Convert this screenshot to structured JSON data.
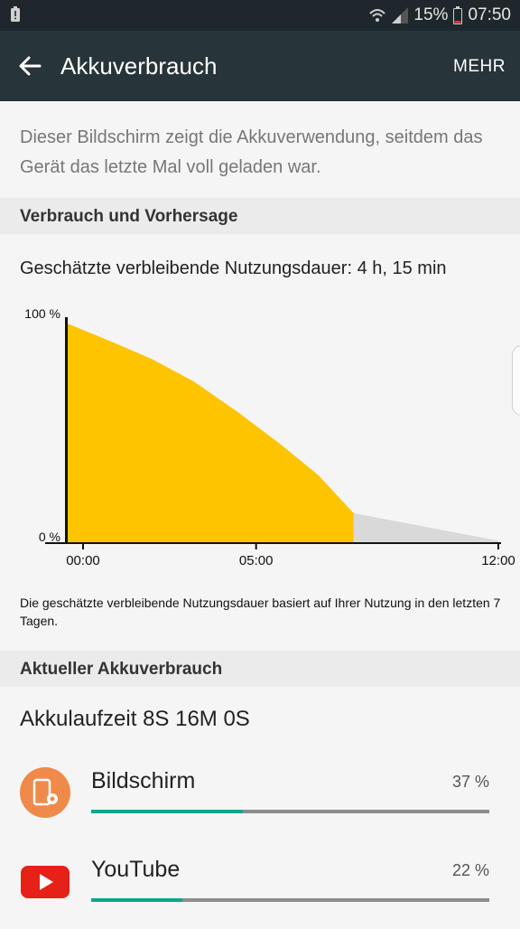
{
  "status_bar": {
    "battery_percent": "15%",
    "time": "07:50"
  },
  "app_bar": {
    "title": "Akkuverbrauch",
    "more_label": "MEHR"
  },
  "intro_text": "Dieser Bildschirm zeigt die Akkuverwendung, seitdem das Gerät das letzte Mal voll geladen war.",
  "usage_section": {
    "header": "Verbrauch und Vorhersage",
    "remaining_text": "Geschätzte verbleibende Nutzungsdauer: 4 h, 15 min",
    "note": "Die geschätzte verbleibende Nutzungsdauer basiert auf Ihrer Nutzung in den letzten 7 Tagen."
  },
  "chart_data": {
    "type": "area",
    "y_ticks": [
      "100 %",
      "0 %"
    ],
    "x_ticks": [
      {
        "label": "00:00",
        "hour": 0
      },
      {
        "label": "05:00",
        "hour": 5
      },
      {
        "label": "12:00",
        "hour": 12
      }
    ],
    "xlim": [
      0,
      12
    ],
    "ylim": [
      0,
      100
    ],
    "series": [
      {
        "kind": "actual",
        "color": "#ffc400",
        "points": [
          [
            -0.45,
            98
          ],
          [
            0.8,
            90
          ],
          [
            2.0,
            82
          ],
          [
            3.2,
            72
          ],
          [
            4.5,
            58
          ],
          [
            5.7,
            44
          ],
          [
            6.8,
            30
          ],
          [
            7.82,
            13
          ]
        ]
      },
      {
        "kind": "prediction",
        "color": "#d9d9d9",
        "points": [
          [
            7.82,
            13
          ],
          [
            12.0,
            0.7
          ]
        ]
      }
    ]
  },
  "current_section": {
    "header": "Aktueller Akkuverbrauch",
    "runtime": "Akkulaufzeit 8S 16M 0S"
  },
  "apps": [
    {
      "name": "Bildschirm",
      "percent_label": "37 %",
      "fraction": 0.38,
      "icon": "screen-settings-icon",
      "icon_color": "#f08a4b"
    },
    {
      "name": "YouTube",
      "percent_label": "22 %",
      "fraction": 0.23,
      "icon": "youtube-icon",
      "icon_color": "#e62117"
    }
  ],
  "colors": {
    "accent": "#12a48c",
    "appbar": "#27343a",
    "statusbar": "#1e272b"
  }
}
